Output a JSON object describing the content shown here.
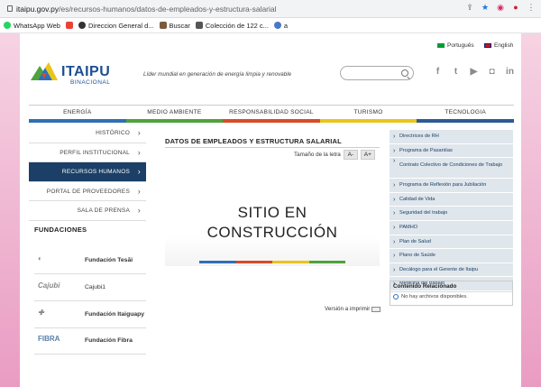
{
  "browser": {
    "url_domain": "itaipu.gov.py",
    "url_path": "/es/recursos-humanos/datos-de-empleados-y-estructura-salarial",
    "bookmarks": [
      "WhatsApp Web",
      "Direccion General d...",
      "Buscar",
      "Colección de 122 c...",
      "a"
    ]
  },
  "header": {
    "lang_pt": "Português",
    "lang_en": "English",
    "logo_text": "ITAIPU",
    "logo_sub": "BINACIONAL",
    "tagline": "Líder mundial en generación de energía limpia y renovable"
  },
  "nav": [
    "ENERGÍA",
    "MEDIO AMBIENTE",
    "RESPONSABILIDAD SOCIAL",
    "TURISMO",
    "TECNOLOGIA"
  ],
  "leftmenu": [
    "HISTÓRICO",
    "PERFIL INSTITUCIONAL",
    "RECURSOS HUMANOS",
    "PORTAL DE PROVEEDORES",
    "SALA DE PRENSA"
  ],
  "fundaciones": {
    "title": "FUNDACIONES",
    "items": [
      {
        "logo": "",
        "label": "Fundación Tesãi"
      },
      {
        "logo": "Cajubi",
        "label": "Cajubi1"
      },
      {
        "logo": "",
        "label": "Fundación Itaiguapy"
      },
      {
        "logo": "FIBRA",
        "label": "Fundación Fibra"
      }
    ]
  },
  "main": {
    "title": "DATOS DE EMPLEADOS Y ESTRUCTURA SALARIAL",
    "font_size_label": "Tamaño de la letra",
    "font_minus": "A-",
    "font_plus": "A+",
    "banner_line1": "SITIO EN",
    "banner_line2": "CONSTRUCCIÓN",
    "print_label": "Versión a imprimir"
  },
  "right_links": [
    "Directrices de RH",
    "Programa de Pasantías",
    "Contrato Colectivo de Condiciones de Trabajo",
    "Programa de Reflexión para Jubilación",
    "Calidad de Vida",
    "Seguridad del trabajo",
    "PAMHO",
    "Plan de Salud",
    "Plano de Saúde",
    "Decálogo para el Gerente de Itaipu",
    "Medicina del trabajo"
  ],
  "related": {
    "title": "Contenido Relacionado",
    "empty": "No hay archivos disponibles."
  },
  "colors": {
    "navy": "#1b3f66",
    "bar": [
      "#2f6fb5",
      "#4ea23b",
      "#d94b29",
      "#e9c51c",
      "#2b5b96"
    ]
  }
}
